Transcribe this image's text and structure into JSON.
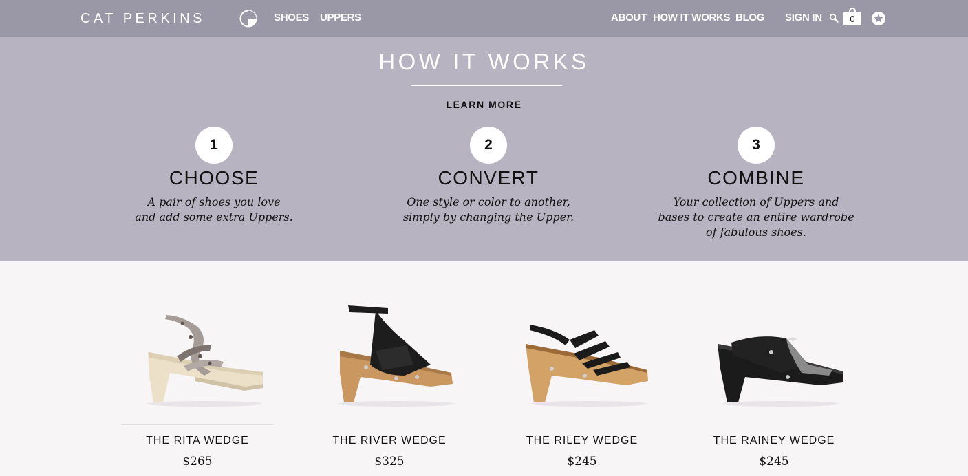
{
  "nav": {
    "logo": "CAT PERKINS",
    "left_links": [
      "SHOES",
      "UPPERS"
    ],
    "right_links": [
      "ABOUT",
      "HOW IT WORKS",
      "BLOG"
    ],
    "sign_in": "SIGN IN",
    "cart_count": "0",
    "icons": [
      "logo-mark-icon",
      "search-icon",
      "cart-icon",
      "star-icon"
    ]
  },
  "hero": {
    "title": "HOW IT WORKS",
    "learn_more": "LEARN MORE",
    "steps": [
      {
        "number": "1",
        "title": "CHOOSE",
        "desc_line1": "A pair of shoes you love",
        "desc_line2": "and add some extra Uppers.",
        "desc_line3": ""
      },
      {
        "number": "2",
        "title": "CONVERT",
        "desc_line1": "One style or color to another,",
        "desc_line2": "simply by changing the Upper.",
        "desc_line3": ""
      },
      {
        "number": "3",
        "title": "COMBINE",
        "desc_line1": "Your collection of Uppers and",
        "desc_line2": "bases to create an entire wardrobe",
        "desc_line3": "of fabulous shoes."
      }
    ]
  },
  "products": [
    {
      "name": "THE RITA WEDGE",
      "price": "$265"
    },
    {
      "name": "THE RIVER WEDGE",
      "price": "$325"
    },
    {
      "name": "THE RILEY WEDGE",
      "price": "$245"
    },
    {
      "name": "THE RAINEY WEDGE",
      "price": "$245"
    }
  ],
  "colors": {
    "nav_bg": "#9a98a6",
    "hero_bg": "#b8b3c0",
    "page_bg": "#f7f5f6"
  }
}
